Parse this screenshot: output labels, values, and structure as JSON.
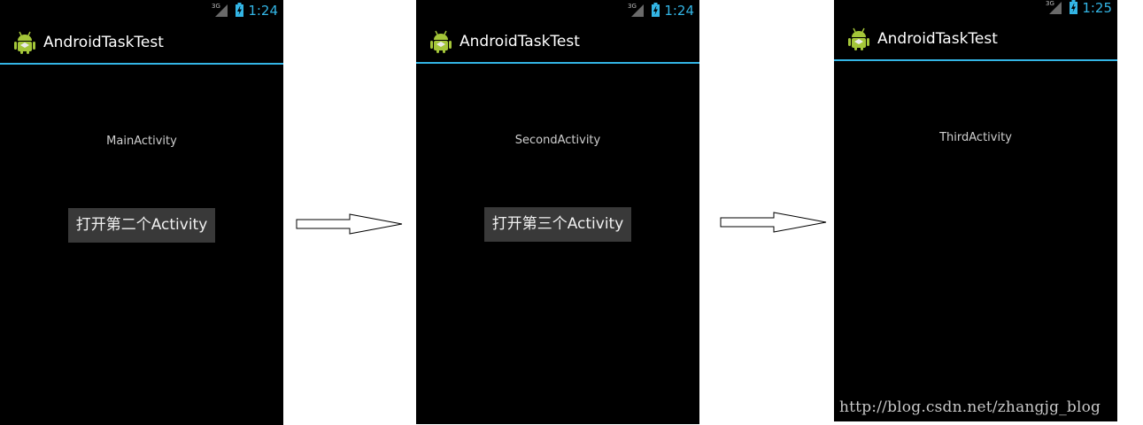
{
  "app": {
    "title": "AndroidTaskTest"
  },
  "accent_color": "#33b5e5",
  "screens": [
    {
      "time": "1:24",
      "network": "3G",
      "activity_label": "MainActivity",
      "button_label": "打开第二个Activity"
    },
    {
      "time": "1:24",
      "network": "3G",
      "activity_label": "SecondActivity",
      "button_label": "打开第三个Activity"
    },
    {
      "time": "1:25",
      "network": "3G",
      "activity_label": "ThirdActivity"
    }
  ],
  "icons": {
    "app": "android-robot-icon",
    "signal": "signal-icon",
    "battery": "battery-charging-icon",
    "arrow": "right-arrow-icon"
  },
  "watermark": "http://blog.csdn.net/zhangjg_blog"
}
